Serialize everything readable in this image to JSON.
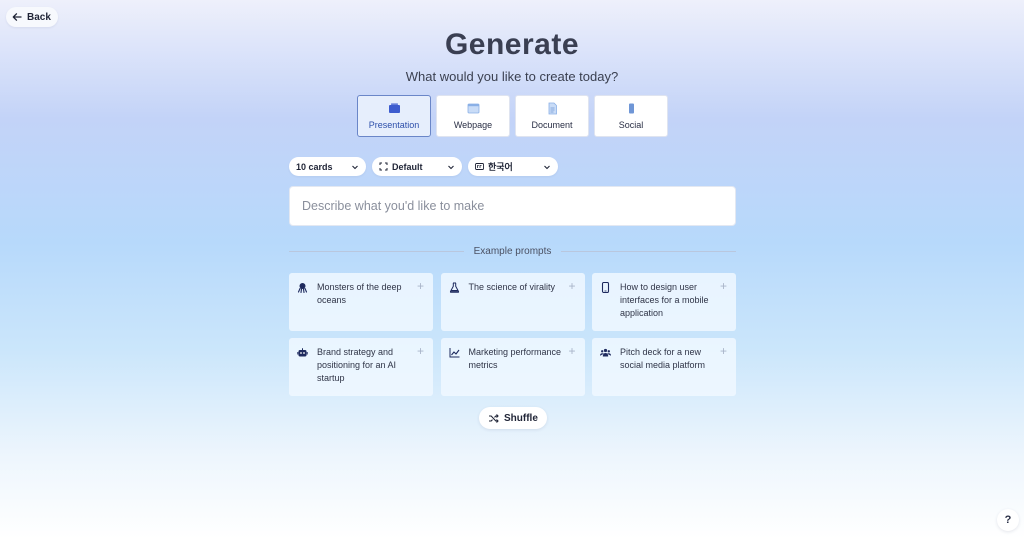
{
  "header": {
    "back_label": "Back",
    "title": "Generate",
    "subtitle": "What would you like to create today?"
  },
  "types": [
    {
      "label": "Presentation",
      "icon": "presentation-icon",
      "active": true
    },
    {
      "label": "Webpage",
      "icon": "webpage-icon",
      "active": false
    },
    {
      "label": "Document",
      "icon": "document-icon",
      "active": false
    },
    {
      "label": "Social",
      "icon": "social-icon",
      "active": false
    }
  ],
  "selectors": {
    "cards": "10 cards",
    "theme": "Default",
    "language": "한국어"
  },
  "prompt": {
    "placeholder": "Describe what you'd like to make",
    "value": ""
  },
  "examples": {
    "heading": "Example prompts",
    "items": [
      {
        "text": "Monsters of the deep oceans",
        "icon": "octopus-icon"
      },
      {
        "text": "The science of virality",
        "icon": "flask-icon"
      },
      {
        "text": "How to design user interfaces for a mobile application",
        "icon": "mobile-icon"
      },
      {
        "text": "Brand strategy and positioning for an AI startup",
        "icon": "robot-icon"
      },
      {
        "text": "Marketing performance metrics",
        "icon": "line-chart-icon"
      },
      {
        "text": "Pitch deck for a new social media platform",
        "icon": "people-icon"
      }
    ],
    "add_symbol": "+"
  },
  "shuffle_label": "Shuffle",
  "help_label": "?",
  "colors": {
    "accent": "#3d5ccf",
    "icon": "#1e2a5e"
  }
}
